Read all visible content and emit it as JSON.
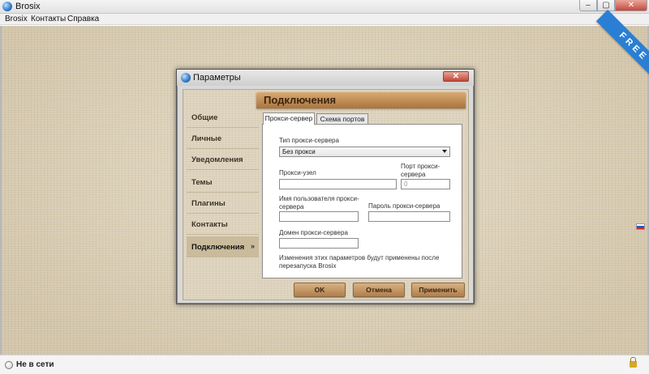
{
  "window": {
    "title": "Brosix",
    "buttons": {
      "minimize": "–",
      "maximize": "▢",
      "close": "✕"
    }
  },
  "menu": [
    "Brosix",
    "Контакты",
    "Справка"
  ],
  "ribbon": "FREE",
  "status": {
    "text": "Не в сети"
  },
  "dialog": {
    "title": "Параметры",
    "close": "✕",
    "header": "Подключения",
    "sidebar": [
      {
        "label": "Общие"
      },
      {
        "label": "Личные"
      },
      {
        "label": "Уведомления"
      },
      {
        "label": "Темы"
      },
      {
        "label": "Плагины"
      },
      {
        "label": "Контакты"
      },
      {
        "label": "Подключения",
        "arrow": "»",
        "active": true
      }
    ],
    "tabs": [
      {
        "label": "Прокси-сервер",
        "active": true
      },
      {
        "label": "Схема портов",
        "active": false
      }
    ],
    "proxy": {
      "type_label": "Тип прокси-сервера",
      "type_value": "Без прокси",
      "host_label": "Прокси-узел",
      "host_value": "",
      "port_label": "Порт прокси-сервера",
      "port_value": "0",
      "username_label": "Имя пользователя прокси-сервера",
      "username_value": "",
      "password_label": "Пароль прокси-сервера",
      "password_value": "",
      "domain_label": "Домен прокси-сервера",
      "domain_value": "",
      "note": "Изменения этих параметров будут применены после перезапуска Brosix"
    },
    "buttons": {
      "ok": "OK",
      "cancel": "Отмена",
      "apply": "Применить"
    }
  }
}
